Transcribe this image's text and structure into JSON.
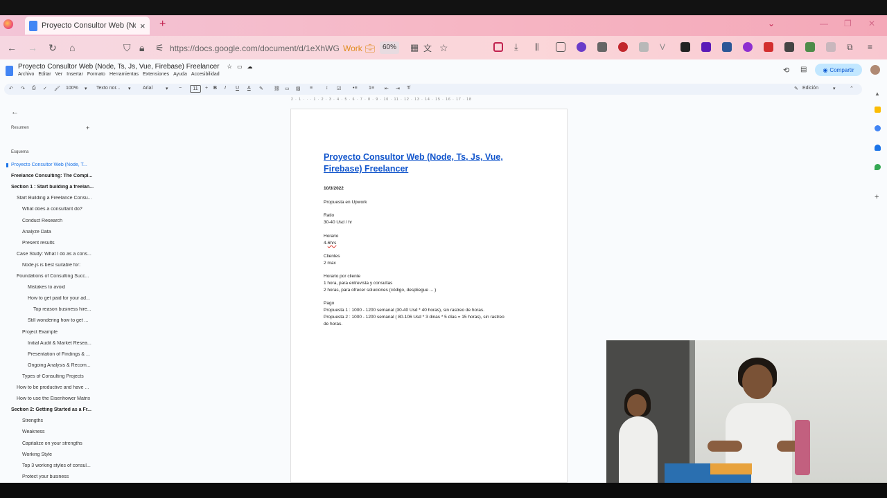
{
  "browser": {
    "tab_title": "Proyecto Consultor Web (Node,",
    "tab_close": "×",
    "new_tab": "+",
    "url": "https://docs.google.com/document/d/1eXhWG",
    "container_label": "Work",
    "zoom": "60%"
  },
  "docs": {
    "title": "Proyecto Consultor Web (Node, Ts, Js, Vue, Firebase) Freelancer",
    "menus": [
      "Archivo",
      "Editar",
      "Ver",
      "Insertar",
      "Formato",
      "Herramientas",
      "Extensiones",
      "Ayuda",
      "Accesibilidad"
    ],
    "share_label": "Compartir",
    "toolbar": {
      "zoom": "100%",
      "style": "Texto nor...",
      "font": "Arial",
      "font_size": "11",
      "mode": "Edición"
    },
    "ruler": "2 · 1 · · · 1 · 2 · 3 · 4 · 5 · 6 · 7 · 8 · 9 · 10 · 11 · 12 · 13 · 14 · 15 · 16 · 17 · 18"
  },
  "sidebar": {
    "summary_label": "Resumen",
    "outline_label": "Esquema",
    "items": [
      {
        "text": "Proyecto Consultor Web (Node, T...",
        "level": 0,
        "active": true
      },
      {
        "text": "Freelance Consulting: The Compl...",
        "level": 0,
        "bold": true
      },
      {
        "text": "Section 1 : Start building a freelan...",
        "level": 0,
        "bold": true
      },
      {
        "text": "Start Building a Freelance Consu...",
        "level": 1
      },
      {
        "text": "What does a consultant do?",
        "level": 2
      },
      {
        "text": "Conduct Research",
        "level": 2
      },
      {
        "text": "Analyze Data",
        "level": 2
      },
      {
        "text": "Present results",
        "level": 2
      },
      {
        "text": "Case Study: What I do as a cons...",
        "level": 1
      },
      {
        "text": "Node.js is best suitable for:",
        "level": 2
      },
      {
        "text": "Foundations of Consulting Succ...",
        "level": 1
      },
      {
        "text": "Mistakes to avoid",
        "level": 3
      },
      {
        "text": "How to get paid for your ad...",
        "level": 3
      },
      {
        "text": "Top reason business hire...",
        "level": 4
      },
      {
        "text": "Still wondering how to get ...",
        "level": 3
      },
      {
        "text": "Project Example",
        "level": 2
      },
      {
        "text": "Initial Audit & Market Resea...",
        "level": 3
      },
      {
        "text": "Presentation of Findings & ...",
        "level": 3
      },
      {
        "text": "Ongoing Analysis & Recom...",
        "level": 3
      },
      {
        "text": "Types of Consulting Projects",
        "level": 2
      },
      {
        "text": "How to be productive and have ...",
        "level": 1
      },
      {
        "text": "How to use the Eisenhower Matrix",
        "level": 1
      },
      {
        "text": "Section 2: Getting Started as a Fr...",
        "level": 0,
        "bold": true
      },
      {
        "text": "Strengths",
        "level": 2
      },
      {
        "text": "Weakness",
        "level": 2
      },
      {
        "text": "Capitalize on your strengths",
        "level": 2
      },
      {
        "text": "Working Style",
        "level": 2
      },
      {
        "text": "Top 3 working styles of consul...",
        "level": 2
      },
      {
        "text": "Protect your business",
        "level": 2
      }
    ]
  },
  "document": {
    "heading_line1": "Proyecto Consultor Web (Node, Ts, Js, Vue,",
    "heading_line2": "Firebase) Freelancer",
    "date": "10/3/2022",
    "proposal": "Propuesta en Upwork",
    "ratio_label": "Ratio",
    "ratio_value": "30-40 Usd / hr",
    "schedule_label": "Horario",
    "schedule_value_prefix": "4-",
    "schedule_value_squiggle": "6hrs",
    "clients_label": "Clientes",
    "clients_value": "2 max",
    "per_client_label": "Horario por cliente",
    "per_client_1": "1 hora, para entrevista y consultas",
    "per_client_2": "2 horas, para ofrecer soluciones (código, despliegue ... )",
    "payment_label": "Pago",
    "payment_1": "Propuesta 1 : 1000 - 1200 semanal (30-40 Usd * 40 horas), sin rastreo de horas.",
    "payment_2a": "Propuesta 2 : 1000 - 1200 semanal ( 80-106 Usd *  3 dinas * 5 días = 15 horas), sin rastreo",
    "payment_2b": "de horas."
  },
  "colors": {
    "link_blue": "#1155cc",
    "share_bg": "#c2e7ff",
    "accent": "#1a73e8"
  }
}
